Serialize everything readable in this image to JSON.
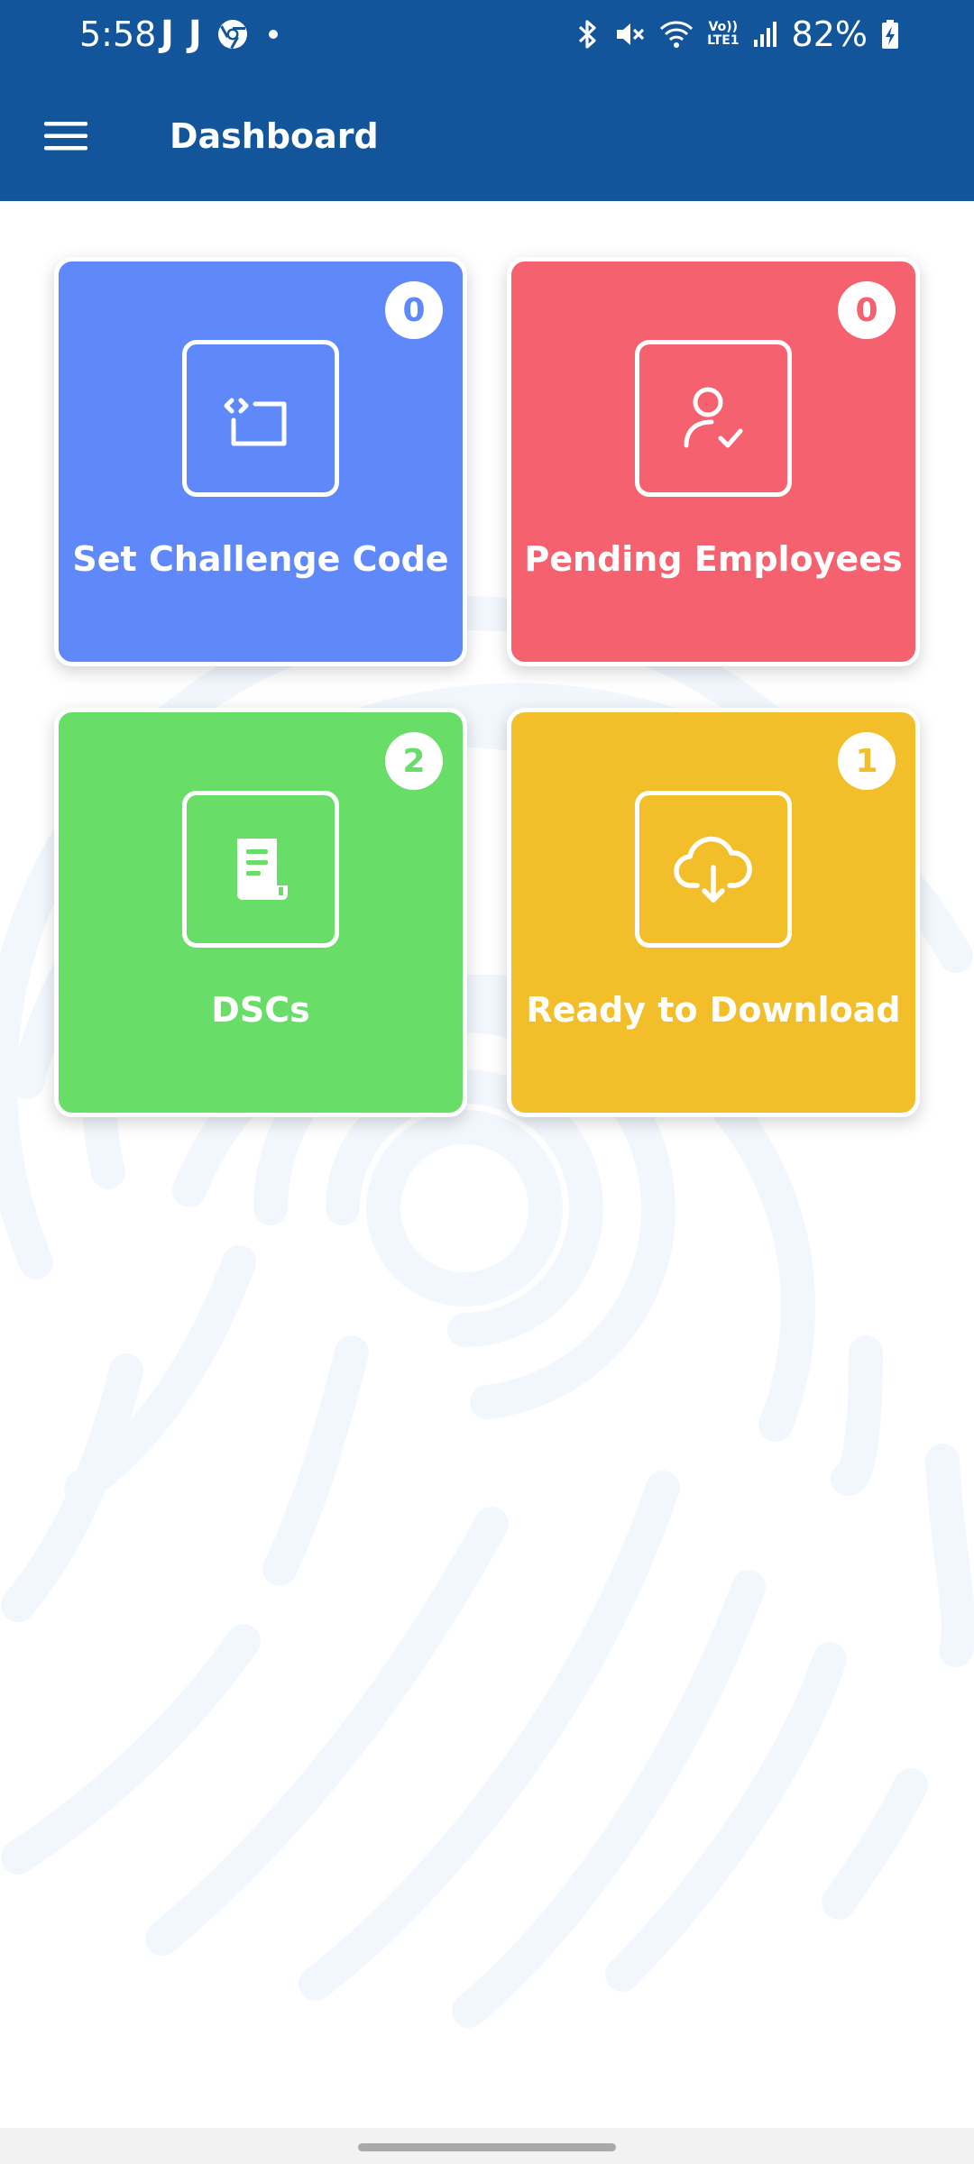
{
  "status_bar": {
    "time": "5:58",
    "notification_icons": [
      "J",
      "J"
    ],
    "battery": "82%",
    "network_label_top": "Vo))",
    "network_label_bottom": "LTE1"
  },
  "app_bar": {
    "title": "Dashboard"
  },
  "tiles": [
    {
      "label": "Set Challenge Code",
      "count": "0",
      "color": "#5f88fa",
      "icon": "code-window-icon"
    },
    {
      "label": "Pending Employees",
      "count": "0",
      "color": "#f5616f",
      "icon": "user-check-icon"
    },
    {
      "label": "DSCs",
      "count": "2",
      "color": "#68dd68",
      "icon": "document-icon"
    },
    {
      "label": "Ready to Download",
      "count": "1",
      "color": "#f2bf2b",
      "icon": "cloud-download-icon"
    }
  ]
}
